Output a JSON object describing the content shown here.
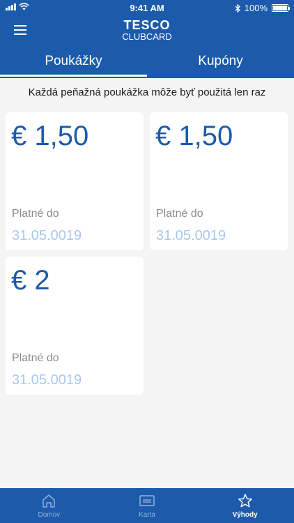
{
  "status_bar": {
    "time": "9:41 AM",
    "battery": "100%"
  },
  "header": {
    "logo_line1": "TESCO",
    "logo_line2": "CLUBCARD"
  },
  "tabs": [
    {
      "label": "Poukážky",
      "active": true
    },
    {
      "label": "Kupóny",
      "active": false
    }
  ],
  "notice": "Každá peňažná poukážka môže byť použitá len raz",
  "vouchers": [
    {
      "amount": "€ 1,50",
      "valid_label": "Platné do",
      "valid_date": "31.05.0019"
    },
    {
      "amount": "€ 1,50",
      "valid_label": "Platné do",
      "valid_date": "31.05.0019"
    },
    {
      "amount": "€ 2",
      "valid_label": "Platné do",
      "valid_date": "31.05.0019"
    }
  ],
  "bottom_nav": [
    {
      "label": "Domov",
      "icon": "home-icon",
      "active": false
    },
    {
      "label": "Karta",
      "icon": "card-icon",
      "active": false
    },
    {
      "label": "Výhody",
      "icon": "star-icon",
      "active": true
    }
  ],
  "colors": {
    "brand": "#1c5bab",
    "date": "#a9c8ea",
    "background": "#f4f4f4"
  }
}
